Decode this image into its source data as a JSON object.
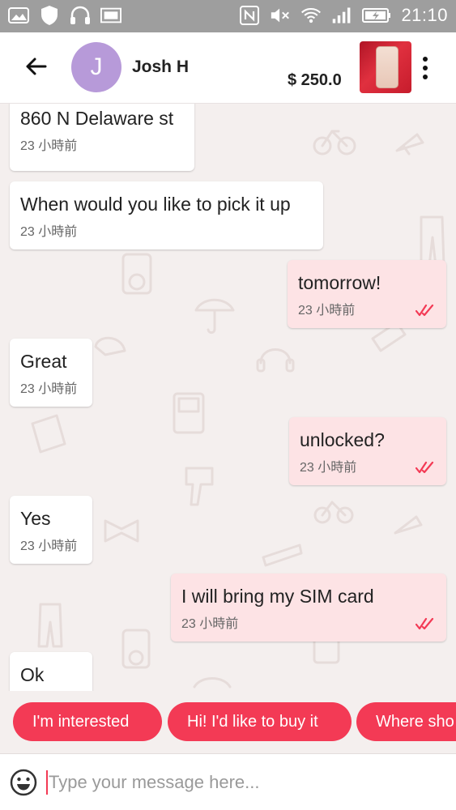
{
  "statusbar": {
    "time": "21:10",
    "icons_left": [
      "gallery-icon",
      "shield-icon",
      "headphones-icon",
      "image-icon"
    ],
    "icons_right": [
      "nfc-icon",
      "mute-icon",
      "wifi-icon",
      "signal-icon",
      "battery-icon"
    ]
  },
  "header": {
    "avatar_letter": "J",
    "contact_name": "Josh H",
    "price": "$ 250.0"
  },
  "messages": [
    {
      "direction": "in",
      "text": "860 N Delaware st",
      "time": "23 小時前"
    },
    {
      "direction": "in",
      "text": "When would you like to pick it up",
      "time": "23 小時前"
    },
    {
      "direction": "out",
      "text": "tomorrow!",
      "time": "23 小時前",
      "status": "read"
    },
    {
      "direction": "in",
      "text": "Great",
      "time": "23 小時前"
    },
    {
      "direction": "out",
      "text": "unlocked?",
      "time": "23 小時前",
      "status": "read"
    },
    {
      "direction": "in",
      "text": "Yes",
      "time": "23 小時前"
    },
    {
      "direction": "out",
      "text": "I will bring my SIM card",
      "time": "23 小時前",
      "status": "read"
    },
    {
      "direction": "in",
      "text": "Ok",
      "time": ""
    }
  ],
  "quick_replies": [
    "I'm interested",
    "Hi! I'd like to buy it",
    "Where sho"
  ],
  "composer": {
    "placeholder": "Type your message here..."
  },
  "colors": {
    "accent": "#f33a55",
    "outgoing_bubble": "#fde3e5",
    "incoming_bubble": "#ffffff",
    "chat_background": "#f4efee",
    "avatar": "#b79ad9",
    "read_check": "#f33a55"
  }
}
